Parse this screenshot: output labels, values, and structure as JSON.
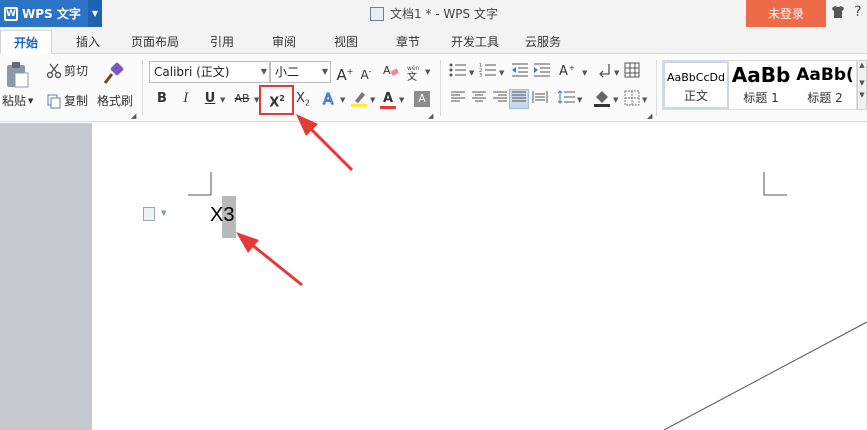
{
  "titlebar": {
    "app_name": "WPS 文字",
    "logo_letter": "W",
    "doc_title": "文档1 * - WPS 文字",
    "login_label": "未登录"
  },
  "tabs": [
    {
      "label": "开始",
      "active": true
    },
    {
      "label": "插入"
    },
    {
      "label": "页面布局"
    },
    {
      "label": "引用"
    },
    {
      "label": "审阅"
    },
    {
      "label": "视图"
    },
    {
      "label": "章节"
    },
    {
      "label": "开发工具"
    },
    {
      "label": "云服务"
    }
  ],
  "clipboard": {
    "paste_label": "粘贴",
    "cut_label": "剪切",
    "copy_label": "复制",
    "format_painter_label": "格式刷"
  },
  "font": {
    "family": "Calibri (正文)",
    "size": "小二",
    "bold": "B",
    "italic": "I",
    "underline": "U",
    "strike": "AB",
    "superscript_base": "X",
    "superscript_mark": "2",
    "subscript_base": "X",
    "subscript_mark": "2",
    "grow": "A",
    "shrink": "A",
    "color_a": "A"
  },
  "styles": [
    {
      "sample": "AaBbCcDd",
      "label": "正文"
    },
    {
      "sample": "AaBb",
      "label": "标题 1"
    },
    {
      "sample": "AaBb(",
      "label": "标题 2"
    }
  ],
  "document": {
    "text": "X3"
  },
  "colors": {
    "accent": "#2b73c5",
    "login": "#ee6b49",
    "annotation": "#e53935"
  }
}
